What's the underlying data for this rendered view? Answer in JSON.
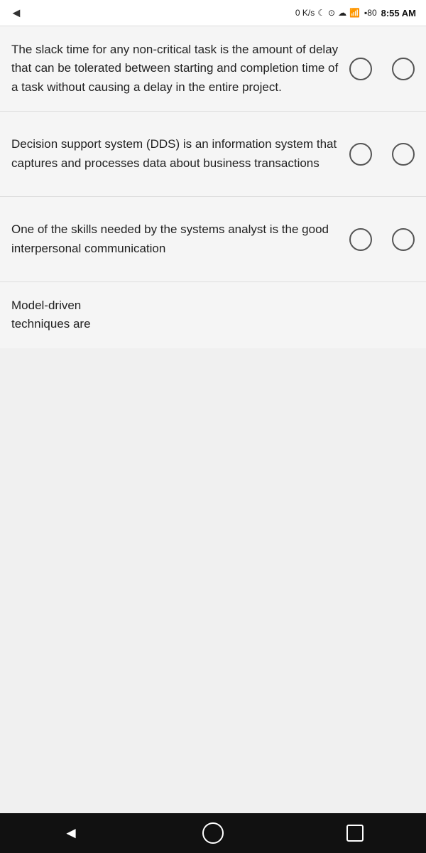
{
  "statusBar": {
    "backArrow": "◄",
    "signal": "0 K/s",
    "icons": "⌀ ⊙ ☁ 4G",
    "battery": "80",
    "time": "8:55 AM"
  },
  "questions": [
    {
      "id": 1,
      "text": "The slack time for any non-critical task is the amount of delay that can be tolerated between starting and completion time of a task without causing a delay in the entire project.",
      "hasRadio": true
    },
    {
      "id": 2,
      "text": "Decision support system (DDS) is an information system that captures and processes data about business transactions",
      "hasRadio": true
    },
    {
      "id": 3,
      "text": "One of the skills needed by the systems analyst is the good interpersonal communication",
      "hasRadio": true
    },
    {
      "id": 4,
      "text": "Model-driven techniques are",
      "hasRadio": false
    }
  ],
  "nav": {
    "back": "◄",
    "home": "○",
    "recent": "□"
  }
}
